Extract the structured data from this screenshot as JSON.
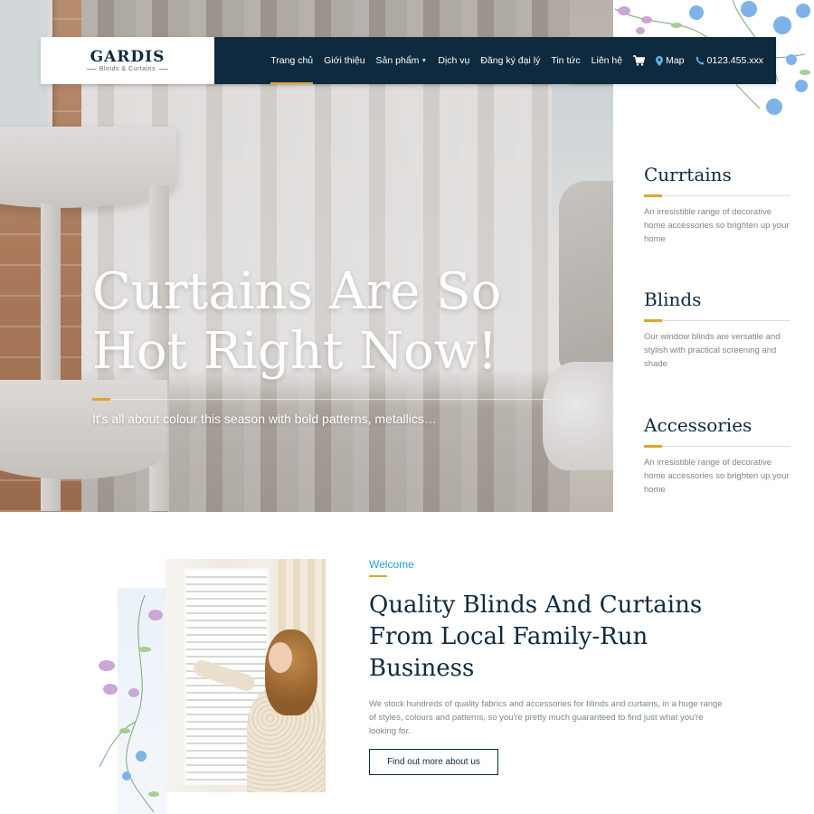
{
  "brand": {
    "name": "GARDIS",
    "tagline": "Blinds & Curtains"
  },
  "nav": {
    "items": [
      {
        "label": "Trang chủ",
        "active": true
      },
      {
        "label": "Giới thiệu"
      },
      {
        "label": "Sản phẩm",
        "has_dropdown": true
      },
      {
        "label": "Dịch vụ"
      },
      {
        "label": "Đăng ký đại lý"
      },
      {
        "label": "Tin tức"
      },
      {
        "label": "Liên hệ"
      }
    ],
    "cart_icon": "cart-icon",
    "map_label": "Map",
    "phone": "0123.455.xxx",
    "accent_color": "#e0a52c",
    "bar_color": "#0e2a3f"
  },
  "hero": {
    "title_line1": "Curtains Are So",
    "title_line2": "Hot Right Now!",
    "subtitle": "It's all about colour this season with bold patterns, metallics…"
  },
  "categories": [
    {
      "title": "Currtains",
      "description": "An irresistible range of decorative home accessories so brighten up your home"
    },
    {
      "title": "Blinds",
      "description": "Our window blinds are versatile and stylish with practical screening and shade"
    },
    {
      "title": "Accessories",
      "description": "An irresistible range of decorative home accessories so brighten up your home"
    }
  ],
  "welcome": {
    "label": "Welcome",
    "title_line1": "Quality Blinds And Curtains",
    "title_line2": "From Local Family-Run",
    "title_line3": "Business",
    "text": "We stock hundreds of quality fabrics and accessories for blinds and curtains, in a huge range of styles, colours and patterns, so you're pretty much guaranteed to find just what you're looking for.",
    "button_label": "Find out more about us",
    "label_color": "#2a9bd5"
  }
}
